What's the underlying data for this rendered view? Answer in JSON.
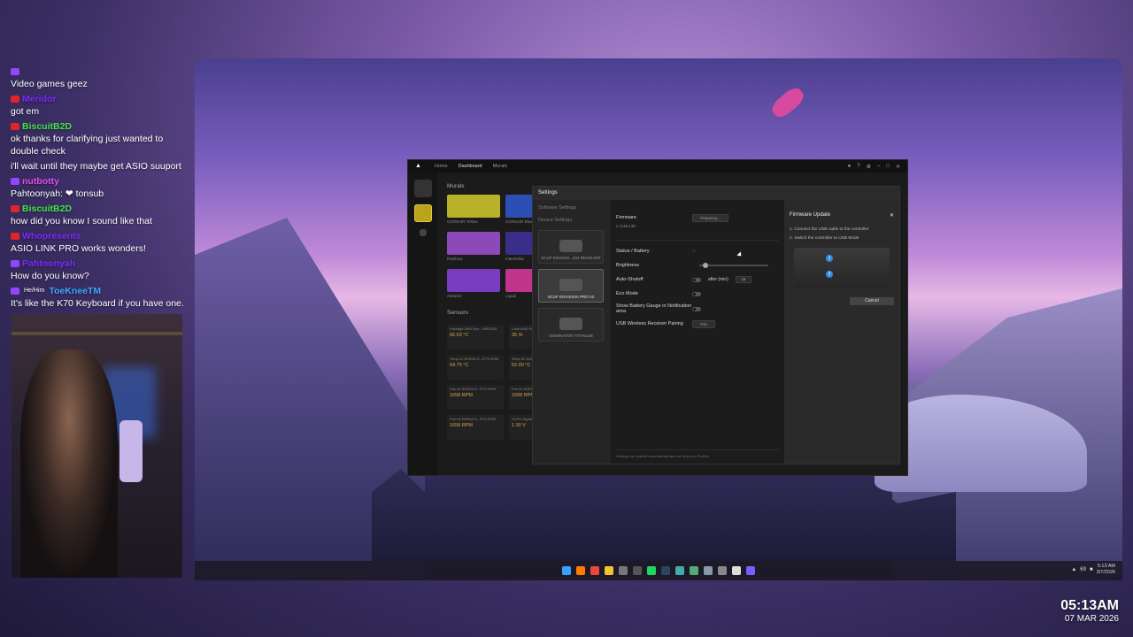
{
  "chat": [
    {
      "platform": "twitch",
      "name": "",
      "color": "#b9a7ff",
      "text": "Video games geez"
    },
    {
      "platform": "youtube",
      "name": "Meridor",
      "color": "#7a2bff",
      "text": "got em"
    },
    {
      "platform": "youtube",
      "name": "BiscuitB2D",
      "color": "#44e34a",
      "text": "ok thanks for clarifying just wanted to double check"
    },
    {
      "platform": "none",
      "name": "",
      "color": "#ffffff",
      "text": "i'll wait until they maybe get ASIO suuport"
    },
    {
      "platform": "twitch",
      "name": "nutbotty",
      "color": "#e14cf4",
      "text": "Pahtoonyah: ❤ tonsub"
    },
    {
      "platform": "youtube",
      "name": "BiscuitB2D",
      "color": "#44e34a",
      "text": "how did you know I sound like that"
    },
    {
      "platform": "youtube",
      "name": "Whopresents",
      "color": "#7a2bff",
      "text": "ASIO LINK PRO works wonders!"
    },
    {
      "platform": "twitch",
      "name": "Pahtoonyah_",
      "color": "#7a2bff",
      "text": "How do you know?"
    },
    {
      "platform": "twitch",
      "name": "ToeKneeTM",
      "pronoun": "He/Him",
      "color": "#3aa8ff",
      "text": "It's like the K70 Keyboard if you have one."
    }
  ],
  "icue": {
    "nav": [
      "Home",
      "Dashboard",
      "Murals"
    ],
    "murals_title": "Murals",
    "murals": [
      {
        "label": "CORSAIR Yellow",
        "color": "#b8b22a"
      },
      {
        "label": "CORSAIR Blue",
        "color": "#2d4fb4"
      },
      {
        "label": "Rainbow",
        "color": "#8c4ab8"
      },
      {
        "label": "Interstellar",
        "color": "#3a2e8a"
      },
      {
        "label": "Abstract",
        "color": "#7a3cc0"
      },
      {
        "label": "Liquid",
        "color": "#c0358a"
      }
    ],
    "sensors_title": "Sensors",
    "sensors": [
      {
        "name": "Package AMD Ryz...9950X3D",
        "value": "66.63 °C"
      },
      {
        "name": "Load AMD Ryz...9950X3D",
        "value": "35 %"
      },
      {
        "name": "Temp #1 NVIDIA G...RTX 5090",
        "value": "64.75 °C"
      },
      {
        "name": "Temp #2 NVIDIA G...RTX 5090",
        "value": "62.00 °C"
      },
      {
        "name": "Fan #1 NVIDIA G...RTX 5090",
        "value": "1658 RPM"
      },
      {
        "name": "Fan #2 NVIDIA G...RTX 5090",
        "value": "1658 RPM"
      },
      {
        "name": "Fan #3 NVIDIA G...RTX 5090",
        "value": "1658 RPM"
      },
      {
        "name": "VCPU Gigabyte...1.00",
        "value": "1.30 V"
      }
    ]
  },
  "settings": {
    "title": "Settings",
    "categories": [
      "Software Settings",
      "Device Settings"
    ],
    "devices": [
      {
        "name": "SCUF ENVISIO...232 RECEIVER"
      },
      {
        "name": "SCUF ENVISION PRO V2"
      },
      {
        "name": "DOMINATOR TITANIUM"
      }
    ],
    "firmware_label": "Firmware",
    "firmware_version": "v. 0.26.130",
    "firmware_status": "Preparing...",
    "status_label": "Status / Battery",
    "brightness_label": "Brightness",
    "autoshutoff_label": "Auto-Shutoff",
    "after_min_label": "after (min)",
    "after_min_value": "15",
    "eco_label": "Eco Mode",
    "gauge_label": "Show Battery Gauge in Notification area",
    "pairing_label": "USB Wireless Receiver Pairing",
    "pair_button": "Pair",
    "footer": "Settings are applied automatically and are linked to Profiles",
    "fw_update_title": "Firmware Update",
    "fw_steps": [
      "1. Connect the USB cable to the controller",
      "2. Switch the controller to USB Mode"
    ],
    "cancel": "Cancel"
  },
  "tray": {
    "volume": "69",
    "time": "5:13 AM",
    "date": "3/7/2026"
  },
  "stream_clock": {
    "time": "05:13AM",
    "date": "07 MAR 2026"
  }
}
